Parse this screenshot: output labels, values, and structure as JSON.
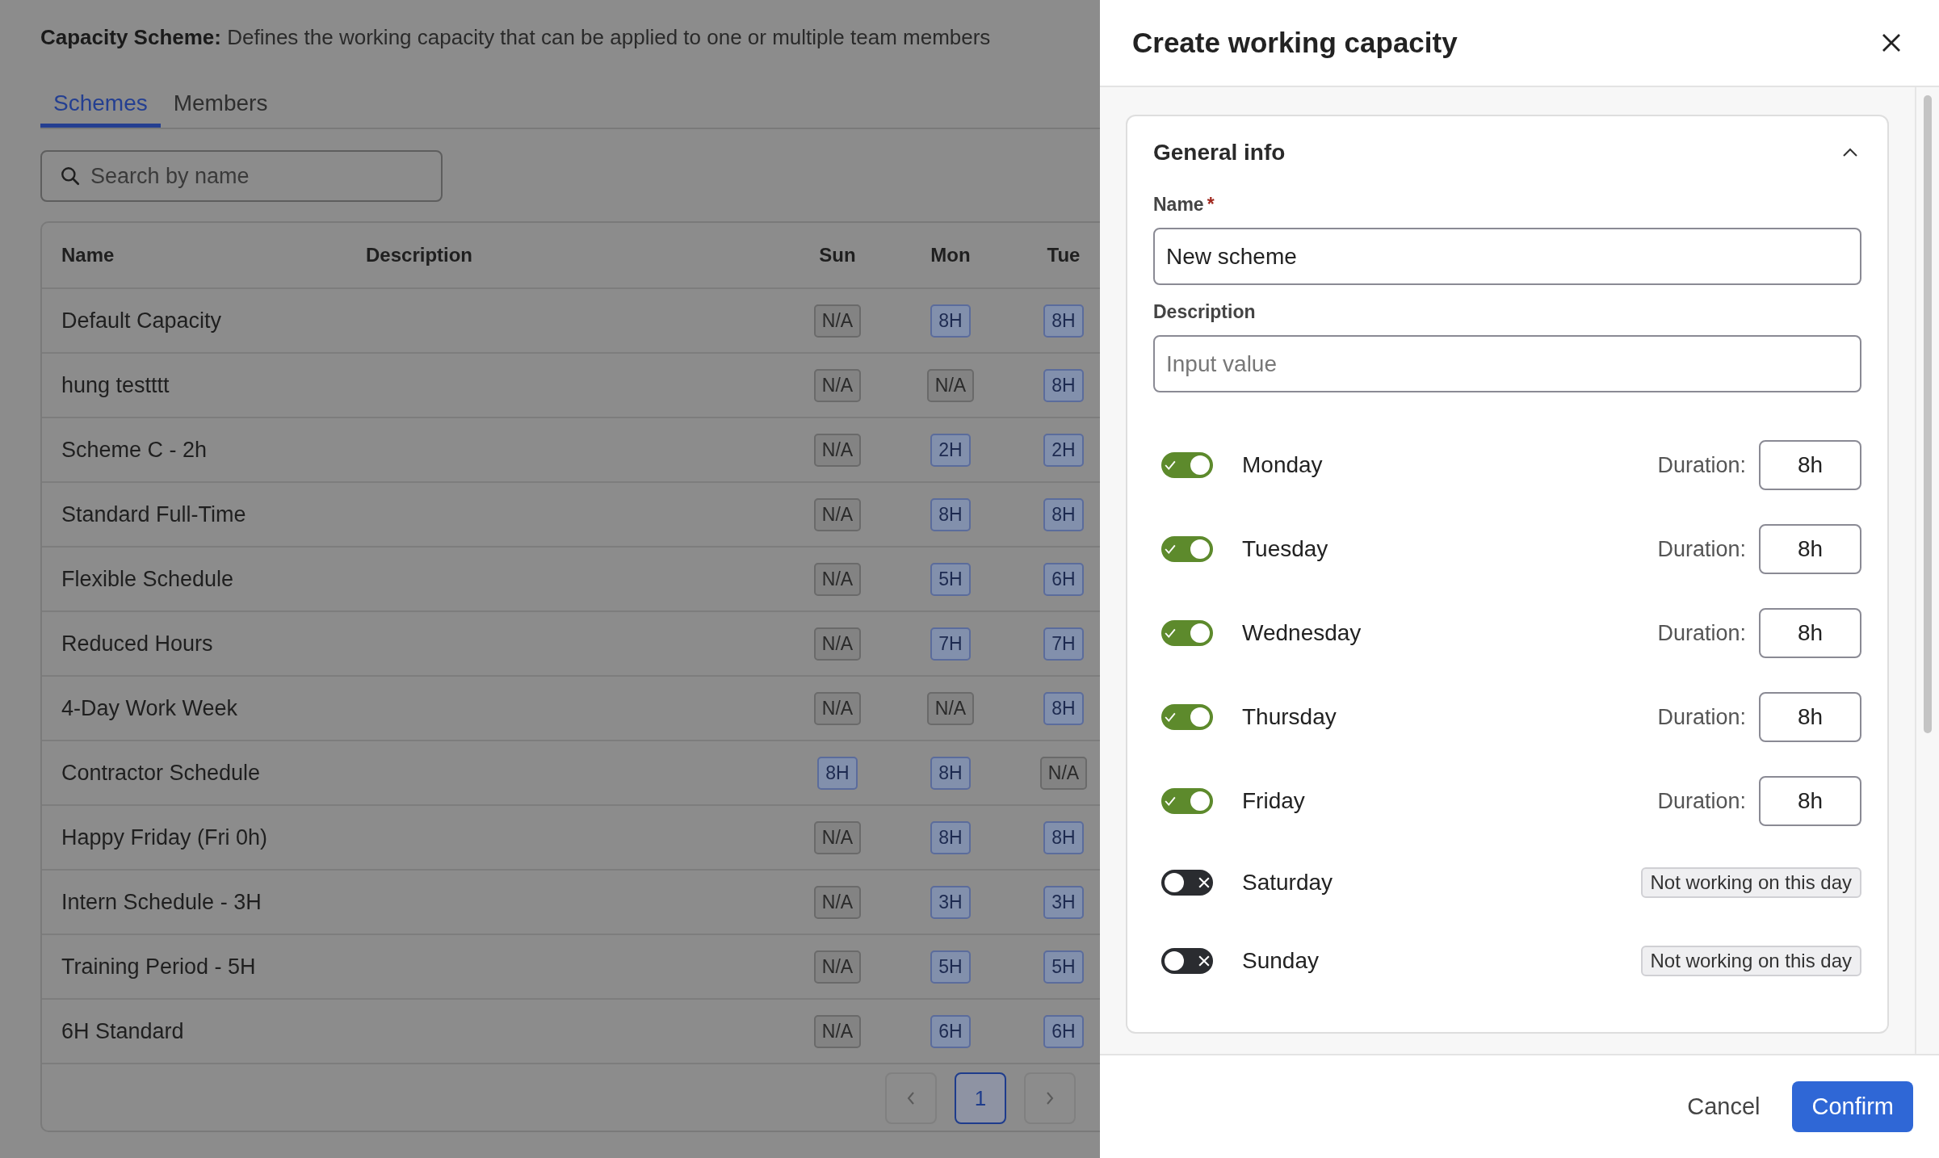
{
  "page": {
    "intro": "**Capacity Scheme:** Defines the working capacity that can be applied to one or multiple team members"
  },
  "tabs": [
    {
      "label": "Schemes",
      "selected": true
    },
    {
      "label": "Members",
      "selected": false
    }
  ],
  "search": {
    "placeholder": "Search by name"
  },
  "table": {
    "columns": [
      "Name",
      "Description",
      "Sun",
      "Mon",
      "Tue"
    ],
    "rows": [
      {
        "name": "Default Capacity",
        "days": [
          {
            "text": "N/A",
            "kind": "na"
          },
          {
            "text": "8H",
            "kind": "hours"
          },
          {
            "text": "8H",
            "kind": "hours"
          }
        ]
      },
      {
        "name": "hung testttt",
        "days": [
          {
            "text": "N/A",
            "kind": "na"
          },
          {
            "text": "N/A",
            "kind": "na"
          },
          {
            "text": "8H",
            "kind": "hours"
          }
        ]
      },
      {
        "name": "Scheme C - 2h",
        "days": [
          {
            "text": "N/A",
            "kind": "na"
          },
          {
            "text": "2H",
            "kind": "hours"
          },
          {
            "text": "2H",
            "kind": "hours"
          }
        ]
      },
      {
        "name": "Standard Full-Time",
        "days": [
          {
            "text": "N/A",
            "kind": "na"
          },
          {
            "text": "8H",
            "kind": "hours"
          },
          {
            "text": "8H",
            "kind": "hours"
          }
        ]
      },
      {
        "name": "Flexible Schedule",
        "days": [
          {
            "text": "N/A",
            "kind": "na"
          },
          {
            "text": "5H",
            "kind": "hours"
          },
          {
            "text": "6H",
            "kind": "hours"
          }
        ]
      },
      {
        "name": "Reduced Hours",
        "days": [
          {
            "text": "N/A",
            "kind": "na"
          },
          {
            "text": "7H",
            "kind": "hours"
          },
          {
            "text": "7H",
            "kind": "hours"
          }
        ]
      },
      {
        "name": "4-Day Work Week",
        "days": [
          {
            "text": "N/A",
            "kind": "na"
          },
          {
            "text": "N/A",
            "kind": "na"
          },
          {
            "text": "8H",
            "kind": "hours"
          }
        ]
      },
      {
        "name": "Contractor Schedule",
        "days": [
          {
            "text": "8H",
            "kind": "hours"
          },
          {
            "text": "8H",
            "kind": "hours"
          },
          {
            "text": "N/A",
            "kind": "na"
          }
        ]
      },
      {
        "name": "Happy Friday (Fri 0h)",
        "days": [
          {
            "text": "N/A",
            "kind": "na"
          },
          {
            "text": "8H",
            "kind": "hours"
          },
          {
            "text": "8H",
            "kind": "hours"
          }
        ]
      },
      {
        "name": "Intern Schedule - 3H",
        "days": [
          {
            "text": "N/A",
            "kind": "na"
          },
          {
            "text": "3H",
            "kind": "hours"
          },
          {
            "text": "3H",
            "kind": "hours"
          }
        ]
      },
      {
        "name": "Training Period - 5H",
        "days": [
          {
            "text": "N/A",
            "kind": "na"
          },
          {
            "text": "5H",
            "kind": "hours"
          },
          {
            "text": "5H",
            "kind": "hours"
          }
        ]
      },
      {
        "name": "6H Standard",
        "days": [
          {
            "text": "N/A",
            "kind": "na"
          },
          {
            "text": "6H",
            "kind": "hours"
          },
          {
            "text": "6H",
            "kind": "hours"
          }
        ]
      }
    ]
  },
  "pagination": {
    "pages": [
      {
        "label": "1",
        "selected": true
      }
    ]
  },
  "drawer": {
    "title": "Create working capacity",
    "section": {
      "title": "General info",
      "expanded": true
    },
    "name_field": {
      "label": "Name",
      "required_mark": "*",
      "value": "New scheme"
    },
    "description_field": {
      "label": "Description",
      "placeholder": "Input value"
    },
    "days": [
      {
        "name": "Monday",
        "on": true,
        "duration_label": "Duration:",
        "duration": "8h"
      },
      {
        "name": "Tuesday",
        "on": true,
        "duration_label": "Duration:",
        "duration": "8h"
      },
      {
        "name": "Wednesday",
        "on": true,
        "duration_label": "Duration:",
        "duration": "8h"
      },
      {
        "name": "Thursday",
        "on": true,
        "duration_label": "Duration:",
        "duration": "8h"
      },
      {
        "name": "Friday",
        "on": true,
        "duration_label": "Duration:",
        "duration": "8h"
      },
      {
        "name": "Saturday",
        "on": false,
        "note": "Not working on this day"
      },
      {
        "name": "Sunday",
        "on": false,
        "note": "Not working on this day"
      }
    ],
    "buttons": {
      "cancel": "Cancel",
      "confirm": "Confirm"
    }
  }
}
